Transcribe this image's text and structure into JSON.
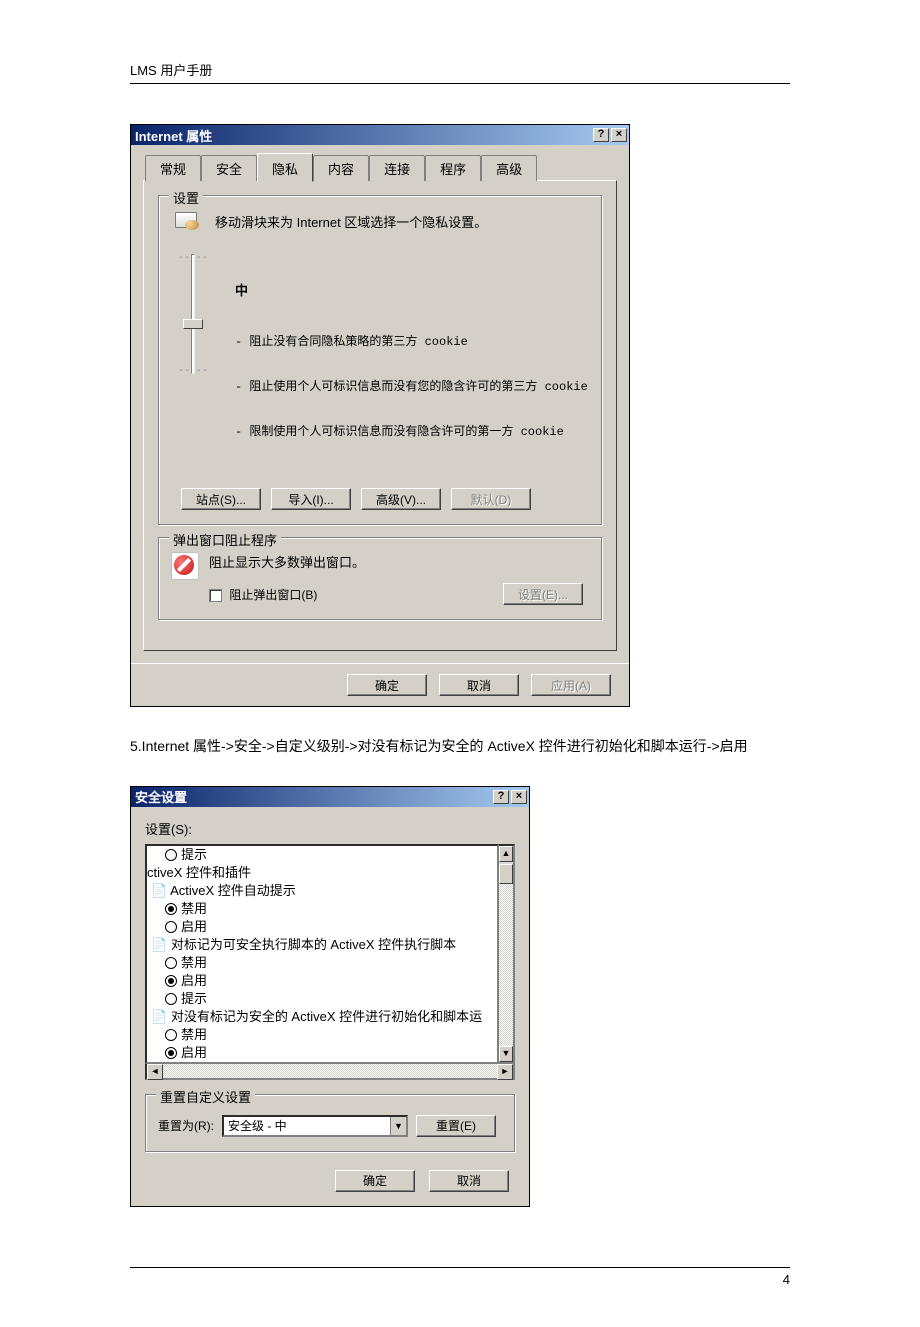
{
  "page": {
    "header": "LMS 用户手册",
    "footer_page": "4",
    "step_text": "5.Internet  属性->安全->自定义级别->对没有标记为安全的 ActiveX 控件进行初始化和脚本运行->启用"
  },
  "dlg1": {
    "title": "Internet 属性",
    "tabs": [
      "常规",
      "安全",
      "隐私",
      "内容",
      "连接",
      "程序",
      "高级"
    ],
    "active_tab": "隐私",
    "settings_group": "设置",
    "slider_desc": "移动滑块来为 Internet 区域选择一个隐私设置。",
    "level_title": "中",
    "level_line1": "- 阻止没有合同隐私策略的第三方 cookie",
    "level_line2": "- 阻止使用个人可标识信息而没有您的隐含许可的第三方 cookie",
    "level_line3": "- 限制使用个人可标识信息而没有隐含许可的第一方 cookie",
    "btn_sites": "站点(S)...",
    "btn_import": "导入(I)...",
    "btn_advanced": "高级(V)...",
    "btn_default": "默认(D)",
    "popup_group": "弹出窗口阻止程序",
    "popup_desc": "阻止显示大多数弹出窗口。",
    "popup_chk": "阻止弹出窗口(B)",
    "btn_popup_settings": "设置(E)...",
    "btn_ok": "确定",
    "btn_cancel": "取消",
    "btn_apply": "应用(A)"
  },
  "dlg2": {
    "title": "安全设置",
    "label": "设置(S):",
    "items": {
      "i0": "提示",
      "cat1": "ctiveX 控件和插件",
      "cat2": "ActiveX 控件自动提示",
      "r2a": "禁用",
      "r2b": "启用",
      "cat3": "对标记为可安全执行脚本的 ActiveX 控件执行脚本",
      "r3a": "禁用",
      "r3b": "启用",
      "r3c": "提示",
      "cat4": "对没有标记为安全的 ActiveX 控件进行初始化和脚本运",
      "r4a": "禁用",
      "r4b": "启用"
    },
    "reset_group": "重置自定义设置",
    "reset_label": "重置为(R):",
    "reset_value": "安全级 - 中",
    "btn_reset": "重置(E)",
    "btn_ok": "确定",
    "btn_cancel": "取消"
  }
}
